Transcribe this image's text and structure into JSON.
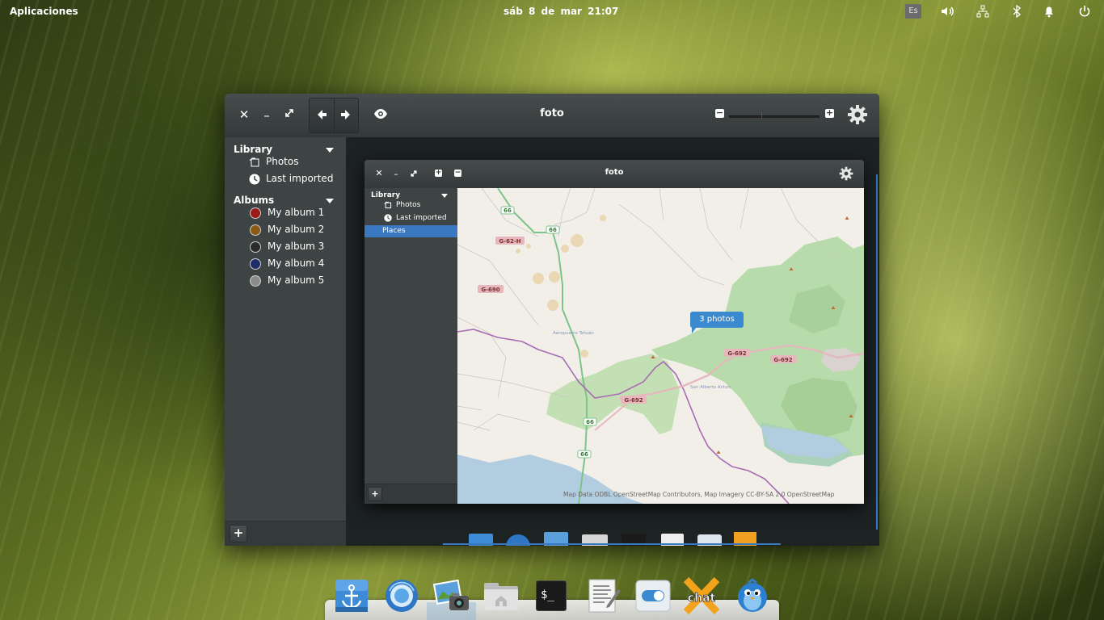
{
  "topbar": {
    "applications": "Aplicaciones",
    "clock": "sáb  8 de mar    21:07",
    "keyboard_layout": "Es",
    "tray_icons": [
      "volume-icon",
      "network-icon",
      "bluetooth-icon",
      "notifications-icon",
      "power-icon"
    ]
  },
  "main_window": {
    "title": "foto",
    "sidebar": {
      "library_header": "Library",
      "library_items": [
        {
          "label": "Photos",
          "icon": "photos-icon"
        },
        {
          "label": "Last imported",
          "icon": "clock-icon"
        }
      ],
      "albums_header": "Albums",
      "albums": [
        {
          "label": "My album 1",
          "color": "#9e1a1a"
        },
        {
          "label": "My album 2",
          "color": "#8a5a14"
        },
        {
          "label": "My album 3",
          "color": "#2b2b2b"
        },
        {
          "label": "My album 4",
          "color": "#1c2f6a"
        },
        {
          "label": "My album 5",
          "color": "#8c8c8c"
        }
      ],
      "add_button": "+"
    }
  },
  "inner_window": {
    "title": "foto",
    "sidebar": {
      "library_header": "Library",
      "items": [
        {
          "label": "Photos",
          "icon": "photos-icon"
        },
        {
          "label": "Last imported",
          "icon": "clock-icon"
        }
      ],
      "places_label": "Places",
      "add_button": "+"
    },
    "map": {
      "marker_label": "3 photos",
      "attribution": "Map Data ODBL OpenStreetMap Contributors, Map Imagery CC-BY-SA 2.0 OpenStreetMap",
      "road_labels": [
        "66",
        "66",
        "G-62-H",
        "G-690",
        "G-692",
        "G-692",
        "G-692",
        "66",
        "66"
      ],
      "place_labels": [
        "Aeropuerto Tetuán",
        "San Alberto Anton"
      ]
    }
  },
  "dock": {
    "items": [
      "anchor-icon",
      "browser-icon",
      "photos-app-icon",
      "files-icon",
      "terminal-icon",
      "text-editor-icon",
      "settings-icon",
      "chat-icon",
      "birdie-icon"
    ],
    "terminal_glyph": "$_",
    "chat_label": "chat"
  },
  "colors": {
    "accent": "#3b78c2",
    "panel": "#3e4444",
    "headerbar": "#3a3f3f"
  }
}
